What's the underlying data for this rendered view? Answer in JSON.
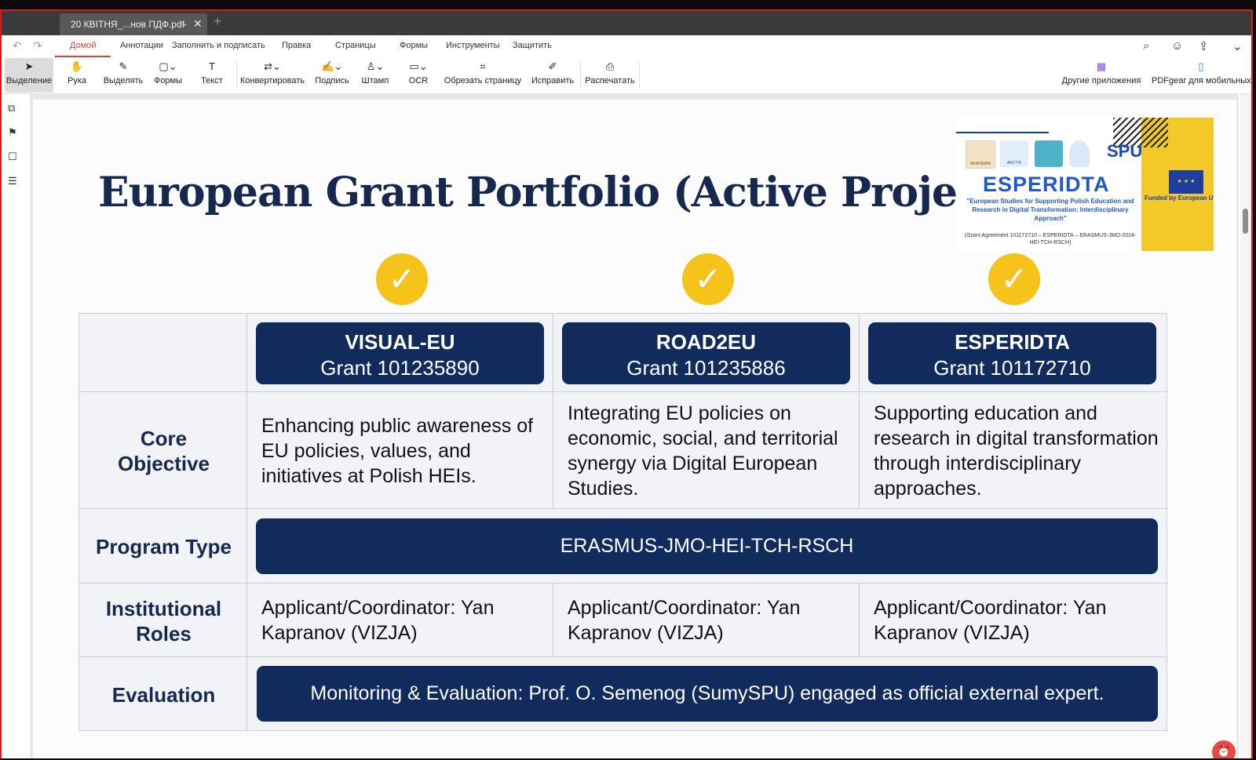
{
  "tab": {
    "title": "20 КВІТНЯ_...нов ПДФ.pdf",
    "chevron": "⌄",
    "close": "✕",
    "new_tab": "+"
  },
  "menu": {
    "undo_icon": "↶",
    "redo_icon": "↷",
    "items": [
      "Домой",
      "Аннотации",
      "Заполнить и подписать",
      "Правка",
      "Страницы",
      "Формы",
      "Инструменты",
      "Защитить"
    ],
    "right_icons": [
      "⌕",
      "☺",
      "⇪",
      "⌄"
    ]
  },
  "toolbar": {
    "tools": [
      {
        "icon": "➤",
        "label": "Выделение"
      },
      {
        "icon": "✋",
        "label": "Рука"
      },
      {
        "icon": "✎",
        "label": "Выделять"
      },
      {
        "icon": "▢⌄",
        "label": "Формы"
      },
      {
        "icon": "T",
        "label": "Текст"
      },
      {
        "icon": "⇄⌄",
        "label": "Конвертировать"
      },
      {
        "icon": "✍⌄",
        "label": "Подпись"
      },
      {
        "icon": "♙⌄",
        "label": "Штамп"
      },
      {
        "icon": "▭⌄",
        "label": "OCR"
      },
      {
        "icon": "⌗",
        "label": "Обрезать страницу"
      },
      {
        "icon": "✐",
        "label": "Исправить"
      },
      {
        "icon": "⎙",
        "label": "Распечатать"
      }
    ],
    "right": [
      {
        "icon": "▦",
        "label": "Другие приложения"
      },
      {
        "icon": "▯",
        "label": "PDFgear для мобильных"
      }
    ]
  },
  "sidebar": {
    "icons": [
      "⧉",
      "⚑",
      "☐",
      "☰"
    ]
  },
  "slide": {
    "title": "European Grant Portfolio (Active Projects",
    "check": "✓",
    "projects": [
      {
        "name": "VISUAL-EU",
        "grant": "Grant 101235890",
        "objective": "Enhancing public awareness of EU policies, values, and initiatives at Polish HEIs.",
        "role": "Applicant/Coordinator: Yan Kapranov (VIZJA)"
      },
      {
        "name": "ROAD2EU",
        "grant": "Grant 101235886",
        "objective": "Integrating EU policies on economic, social, and territorial synergy via Digital European Studies.",
        "role": "Applicant/Coordinator: Yan Kapranov (VIZJA)"
      },
      {
        "name": "ESPERIDTA",
        "grant": "Grant 101172710",
        "objective": "Supporting education and research in digital transformation through interdisciplinary approaches.",
        "role": "Applicant/Coordinator: Yan Kapranov (VIZJA)"
      }
    ],
    "row_labels": {
      "objective": "Core Objective",
      "program": "Program Type",
      "roles": "Institutional Roles",
      "evaluation": "Evaluation"
    },
    "program_type": "ERASMUS-JMO-HEI-TCH-RSCH",
    "evaluation": "Monitoring & Evaluation: Prof. O. Semenog (SumySPU) engaged as official external expert."
  },
  "badge": {
    "logos": [
      "AKADEMIA",
      "ARCTIS",
      "",
      ""
    ],
    "spu": "SPU",
    "title": "ESPERIDTA",
    "subtitle": "\"European Studies for Supporting Polish Education and Research in Digital Transformation: Interdisciplinary Approach\"",
    "grant": "(Grant Agreement 101172710 – ESPERIDTA – ERASMUS-JMO-2024-HEI-TCH-RSCH)",
    "eu_stars": "★ ★ ★",
    "funded": "Funded by European Uni"
  },
  "float_icon": "⏰",
  "colors": {
    "accent": "#e0413b",
    "navy": "#102b5c",
    "gold": "#f6c31b",
    "frame": "#d21d1d"
  }
}
